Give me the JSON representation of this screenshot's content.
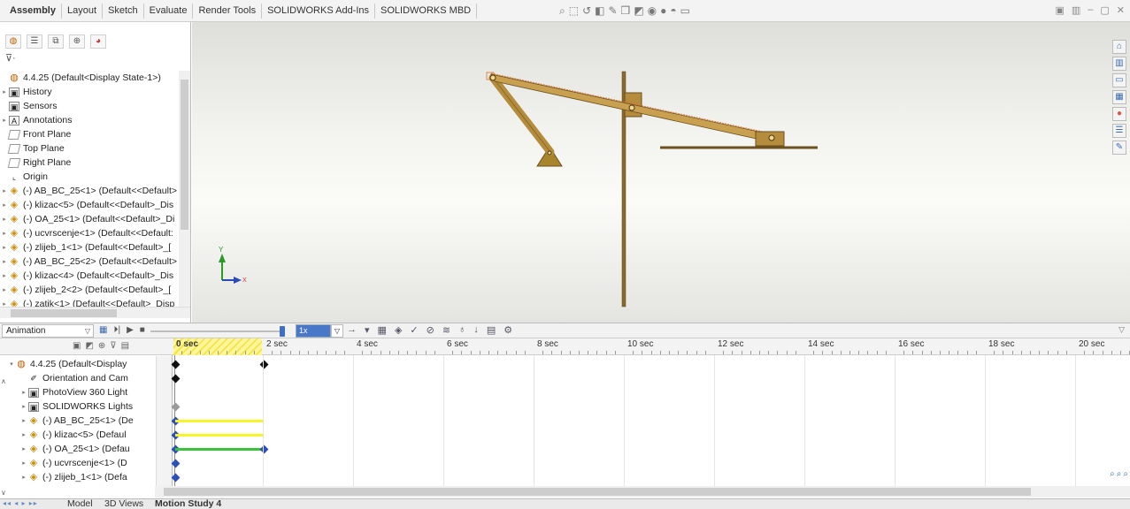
{
  "command_tabs": [
    "Assembly",
    "Layout",
    "Sketch",
    "Evaluate",
    "Render Tools",
    "SOLIDWORKS Add-Ins",
    "SOLIDWORKS MBD"
  ],
  "feature_tree": {
    "root": "4.4.25  (Default<Display State-1>)",
    "items": [
      {
        "label": "History",
        "icon": "history-icon",
        "arrow": true
      },
      {
        "label": "Sensors",
        "icon": "sensor-icon",
        "arrow": false
      },
      {
        "label": "Annotations",
        "icon": "annotation-icon",
        "arrow": true
      },
      {
        "label": "Front Plane",
        "icon": "plane-icon",
        "arrow": false
      },
      {
        "label": "Top Plane",
        "icon": "plane-icon",
        "arrow": false
      },
      {
        "label": "Right Plane",
        "icon": "plane-icon",
        "arrow": false
      },
      {
        "label": "Origin",
        "icon": "origin-icon",
        "arrow": false
      },
      {
        "label": "(-) AB_BC_25<1> (Default<<Default>",
        "icon": "part-icon",
        "arrow": true
      },
      {
        "label": "(-) klizac<5> (Default<<Default>_Dis",
        "icon": "part-icon",
        "arrow": true
      },
      {
        "label": "(-) OA_25<1> (Default<<Default>_Di",
        "icon": "part-icon",
        "arrow": true
      },
      {
        "label": "(-) ucvrscenje<1> (Default<<Default:",
        "icon": "part-icon",
        "arrow": true
      },
      {
        "label": "(-) zlijeb_1<1> (Default<<Default>_[",
        "icon": "part-icon",
        "arrow": true
      },
      {
        "label": "(-) AB_BC_25<2> (Default<<Default>",
        "icon": "part-icon",
        "arrow": true
      },
      {
        "label": "(-) klizac<4> (Default<<Default>_Dis",
        "icon": "part-icon",
        "arrow": true
      },
      {
        "label": "(-) zlijeb_2<2> (Default<<Default>_[",
        "icon": "part-icon",
        "arrow": true
      },
      {
        "label": "(-) zatik<1> (Default<<Default>_Disp",
        "icon": "part-icon",
        "arrow": true
      }
    ]
  },
  "motion_manager": {
    "study_type": "Animation",
    "speed": "1x",
    "tree": {
      "root": "4.4.25  (Default<Display",
      "items": [
        {
          "label": "Orientation and Cam",
          "icon": "camera-icon",
          "arrow": false
        },
        {
          "label": "PhotoView 360 Light",
          "icon": "light-icon",
          "arrow": true
        },
        {
          "label": "SOLIDWORKS Lights",
          "icon": "light-icon",
          "arrow": true
        },
        {
          "label": "(-) AB_BC_25<1> (De",
          "icon": "part-icon",
          "arrow": true
        },
        {
          "label": "(-) klizac<5> (Defaul",
          "icon": "part-icon",
          "arrow": true
        },
        {
          "label": "(-) OA_25<1> (Defau",
          "icon": "part-icon",
          "arrow": true
        },
        {
          "label": "(-) ucvrscenje<1> (D",
          "icon": "part-icon",
          "arrow": true
        },
        {
          "label": "(-) zlijeb_1<1> (Defa",
          "icon": "part-icon",
          "arrow": true
        }
      ]
    },
    "timeline_labels": [
      "0 sec",
      "2 sec",
      "4 sec",
      "6 sec",
      "8 sec",
      "10 sec",
      "12 sec",
      "14 sec",
      "16 sec",
      "18 sec",
      "20 sec"
    ],
    "current_time_sec": 2,
    "colors": {
      "yellow_bar": "#f7f42a",
      "green_bar": "#3cc33c",
      "key_black": "#111111",
      "key_blue": "#2f4fb8",
      "key_grey": "#9a9a9a"
    }
  },
  "bottom_tabs": [
    "Model",
    "3D Views",
    "Motion Study 4"
  ],
  "colors": {
    "part_fill": "#b48c3c",
    "part_stroke": "#6b5020",
    "selection": "#e0702a"
  }
}
